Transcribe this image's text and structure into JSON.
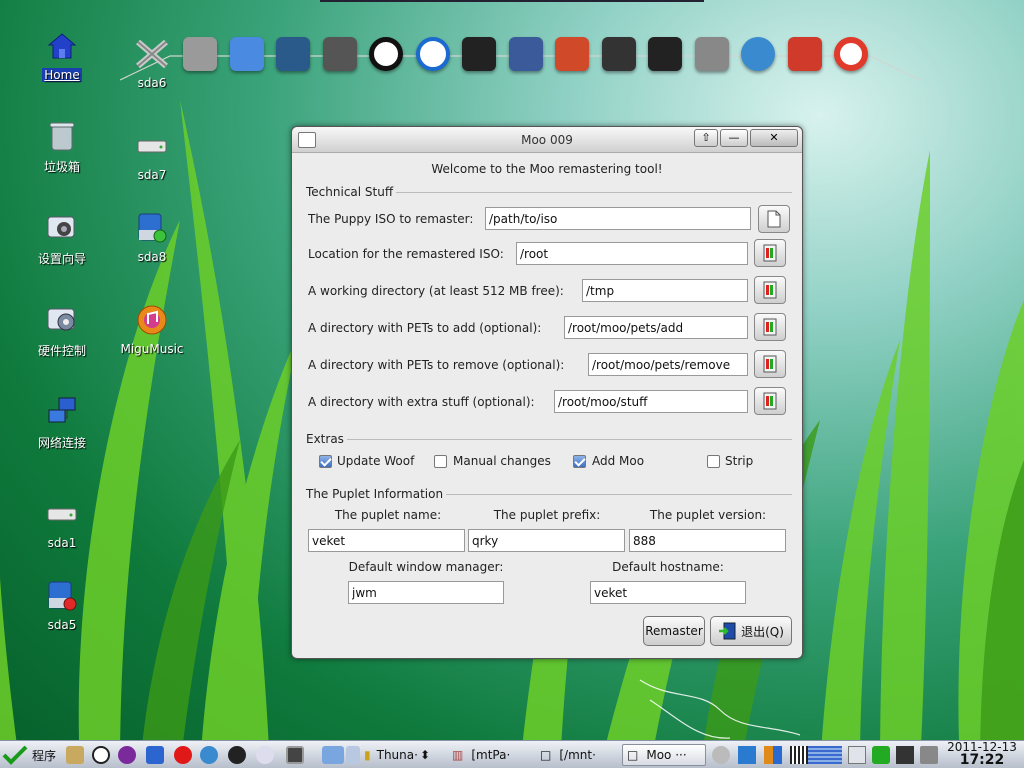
{
  "desktop": {
    "icons": [
      {
        "label": "Home",
        "name": "home"
      },
      {
        "label": "sda6",
        "name": "sda6"
      },
      {
        "label": "垃圾箱",
        "name": "trash"
      },
      {
        "label": "sda7",
        "name": "sda7"
      },
      {
        "label": "设置向导",
        "name": "setup-wizard"
      },
      {
        "label": "sda8",
        "name": "sda8"
      },
      {
        "label": "硬件控制",
        "name": "hardware-control"
      },
      {
        "label": "MiguMusic",
        "name": "migumusic"
      },
      {
        "label": "网络连接",
        "name": "network-connection"
      },
      {
        "label": "sda1",
        "name": "sda1"
      },
      {
        "label": "sda5",
        "name": "sda5"
      }
    ]
  },
  "dock": {
    "icons": [
      "crossover-icon",
      "monitor-icon",
      "globe-icon",
      "notepad-icon",
      "amule-icon",
      "media-player-icon",
      "qq-penguin-icon",
      "inkscape-icon",
      "presentation-icon",
      "paint-icon",
      "usb-drive-icon",
      "camera-icon",
      "refresh-icon",
      "backup-icon",
      "lifebuoy-icon"
    ]
  },
  "window": {
    "title": "Moo 009",
    "welcome": "Welcome to the Moo remastering tool!",
    "tech_section": "Technical Stuff",
    "fields": [
      {
        "label": "The Puppy ISO to remaster:",
        "value": "/path/to/iso",
        "name": "puppy-iso"
      },
      {
        "label": "Location for the remastered ISO:",
        "value": "/root",
        "name": "remastered-location"
      },
      {
        "label": "A working directory (at least 512 MB free):",
        "value": "/tmp",
        "name": "working-directory"
      },
      {
        "label": "A directory with PETs to add (optional):",
        "value": "/root/moo/pets/add",
        "name": "pets-add"
      },
      {
        "label": "A directory with PETs to remove (optional):",
        "value": "/root/moo/pets/remove",
        "name": "pets-remove"
      },
      {
        "label": "A directory with extra stuff (optional):",
        "value": "/root/moo/stuff",
        "name": "extra-stuff"
      }
    ],
    "extras_section": "Extras",
    "extras": [
      {
        "label": "Update Woof",
        "checked": true,
        "name": "update-woof"
      },
      {
        "label": "Manual changes",
        "checked": false,
        "name": "manual-changes"
      },
      {
        "label": "Add Moo",
        "checked": true,
        "name": "add-moo"
      },
      {
        "label": "Strip",
        "checked": false,
        "name": "strip"
      }
    ],
    "puplet_section": "The Puplet Information",
    "puplet_name_label": "The puplet name:",
    "puplet_name": "veket",
    "puplet_prefix_label": "The puplet prefix:",
    "puplet_prefix": "qrky",
    "puplet_version_label": "The puplet version:",
    "puplet_version": "888",
    "wm_label": "Default window manager:",
    "wm": "jwm",
    "hostname_label": "Default hostname:",
    "hostname": "veket",
    "remaster_button": "Remaster",
    "quit_button": "退出(Q)"
  },
  "taskbar": {
    "start_label": "程序",
    "tasks": [
      {
        "label": "Thuna·",
        "name": "task-thunar"
      },
      {
        "label": "[mtPa·",
        "name": "task-mtpaint"
      },
      {
        "label": "[/mnt·",
        "name": "task-mnt"
      },
      {
        "label": "Moo ···",
        "name": "task-moo"
      }
    ],
    "date": "2011-12-13",
    "time": "17:22"
  }
}
